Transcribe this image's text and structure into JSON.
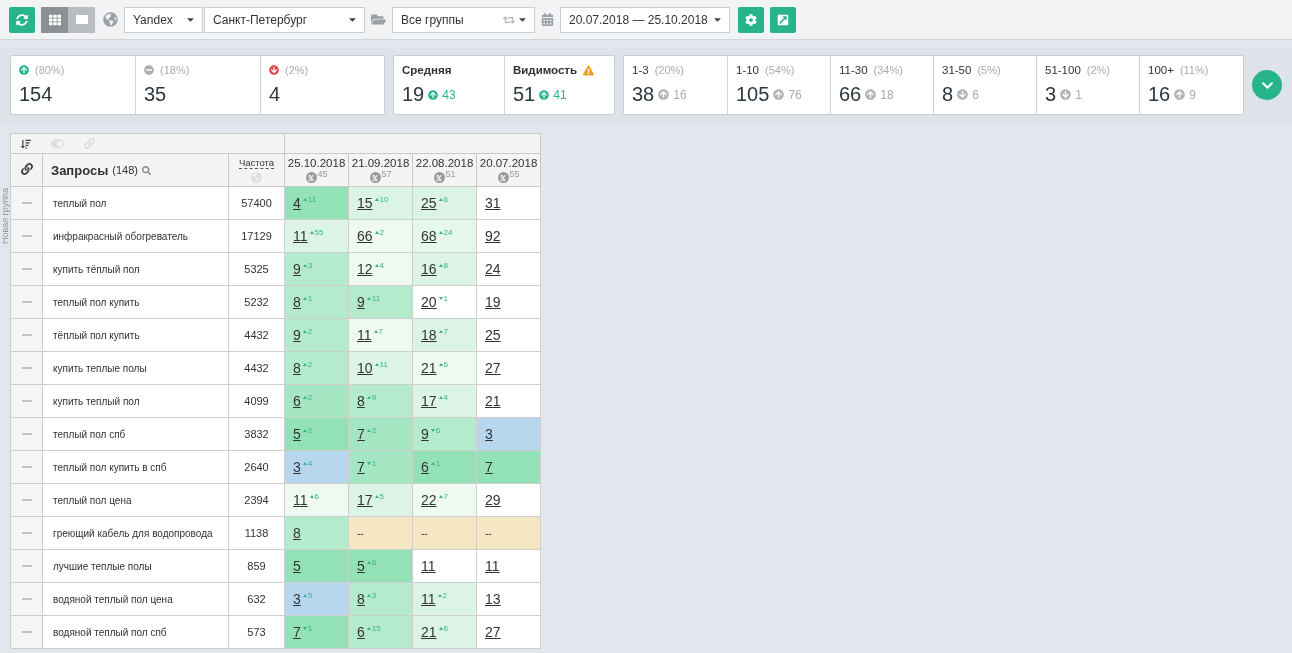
{
  "toolbar": {
    "view_modes": [
      {
        "kind": "grid",
        "selected": true
      },
      {
        "kind": "list",
        "selected": false
      }
    ],
    "search_engine": "Yandex",
    "region": "Санкт-Петербург",
    "group": "Все группы",
    "date_range": "20.07.2018 — 25.10.2018"
  },
  "summary": {
    "trend": [
      {
        "kind": "up",
        "percent": "(80%)",
        "value": "154"
      },
      {
        "kind": "same",
        "percent": "(18%)",
        "value": "35"
      },
      {
        "kind": "down",
        "percent": "(2%)",
        "value": "4"
      }
    ],
    "averages": [
      {
        "label": "Средняя",
        "value": "19",
        "delta": "43",
        "warning": false
      },
      {
        "label": "Видимость",
        "value": "51",
        "delta": "41",
        "warning": true
      }
    ],
    "ranges": [
      {
        "label": "1-3",
        "percent": "(20%)",
        "value": "38",
        "rising": true,
        "delta": "16"
      },
      {
        "label": "1-10",
        "percent": "(54%)",
        "value": "105",
        "rising": true,
        "delta": "76"
      },
      {
        "label": "11-30",
        "percent": "(34%)",
        "value": "66",
        "rising": true,
        "delta": "18"
      },
      {
        "label": "31-50",
        "percent": "(5%)",
        "value": "8",
        "rising": false,
        "delta": "6"
      },
      {
        "label": "51-100",
        "percent": "(2%)",
        "value": "3",
        "rising": false,
        "delta": "1"
      },
      {
        "label": "100+",
        "percent": "(11%)",
        "value": "16",
        "rising": true,
        "delta": "9"
      }
    ]
  },
  "table": {
    "group_label": "Новая группа",
    "query_header": "Запросы",
    "query_count": "(148)",
    "frequency_header": "Частота",
    "dates": [
      {
        "date": "25.10.2018",
        "score": "45"
      },
      {
        "date": "21.09.2018",
        "score": "57"
      },
      {
        "date": "22.08.2018",
        "score": "51"
      },
      {
        "date": "20.07.2018",
        "score": "55"
      }
    ],
    "rows": [
      {
        "query": "теплый пол",
        "frequency": "57400",
        "positions": [
          {
            "value": "4",
            "delta": "11",
            "rising": true,
            "color": "#93e2b7"
          },
          {
            "value": "15",
            "delta": "10",
            "rising": true,
            "color": "#dcf4e6"
          },
          {
            "value": "25",
            "delta": "6",
            "rising": true,
            "color": "#dcf4e6"
          },
          {
            "value": "31",
            "color": "#ffffff"
          }
        ]
      },
      {
        "query": "инфракрасный обогреватель",
        "frequency": "17129",
        "positions": [
          {
            "value": "11",
            "delta": "55",
            "rising": true,
            "color": "#dcf4e6"
          },
          {
            "value": "66",
            "delta": "2",
            "rising": true,
            "color": "#eef9f2"
          },
          {
            "value": "68",
            "delta": "24",
            "rising": true,
            "color": "#e6f7ec"
          },
          {
            "value": "92",
            "color": "#ffffff"
          }
        ]
      },
      {
        "query": "купить тёплый пол",
        "frequency": "5325",
        "positions": [
          {
            "value": "9",
            "delta": "3",
            "rising": true,
            "color": "#b5ebcd"
          },
          {
            "value": "12",
            "delta": "4",
            "rising": true,
            "color": "#eef9f2"
          },
          {
            "value": "16",
            "delta": "8",
            "rising": true,
            "color": "#dcf4e6"
          },
          {
            "value": "24",
            "color": "#ffffff"
          }
        ]
      },
      {
        "query": "теплый пол купить",
        "frequency": "5232",
        "positions": [
          {
            "value": "8",
            "delta": "1",
            "rising": true,
            "color": "#b5ebcd"
          },
          {
            "value": "9",
            "delta": "11",
            "rising": true,
            "color": "#b5ebcd"
          },
          {
            "value": "20",
            "delta": "1",
            "rising": false,
            "color": "#ffffff"
          },
          {
            "value": "19",
            "color": "#ffffff"
          }
        ]
      },
      {
        "query": "тёплый пол купить",
        "frequency": "4432",
        "positions": [
          {
            "value": "9",
            "delta": "2",
            "rising": true,
            "color": "#b5ebcd"
          },
          {
            "value": "11",
            "delta": "7",
            "rising": true,
            "color": "#eef9f2"
          },
          {
            "value": "18",
            "delta": "7",
            "rising": true,
            "color": "#dcf4e6"
          },
          {
            "value": "25",
            "color": "#ffffff"
          }
        ]
      },
      {
        "query": "купить теплые полы",
        "frequency": "4432",
        "positions": [
          {
            "value": "8",
            "delta": "2",
            "rising": true,
            "color": "#b5ebcd"
          },
          {
            "value": "10",
            "delta": "11",
            "rising": true,
            "color": "#dcf4e6"
          },
          {
            "value": "21",
            "delta": "6",
            "rising": true,
            "color": "#eef9f2"
          },
          {
            "value": "27",
            "color": "#ffffff"
          }
        ]
      },
      {
        "query": "купить теплый пол",
        "frequency": "4099",
        "positions": [
          {
            "value": "6",
            "delta": "2",
            "rising": true,
            "color": "#a3e6c1"
          },
          {
            "value": "8",
            "delta": "9",
            "rising": true,
            "color": "#b5ebcd"
          },
          {
            "value": "17",
            "delta": "4",
            "rising": true,
            "color": "#dcf4e6"
          },
          {
            "value": "21",
            "color": "#ffffff"
          }
        ]
      },
      {
        "query": "теплый пол спб",
        "frequency": "3832",
        "positions": [
          {
            "value": "5",
            "delta": "2",
            "rising": true,
            "color": "#93e2b7"
          },
          {
            "value": "7",
            "delta": "2",
            "rising": true,
            "color": "#a3e6c1"
          },
          {
            "value": "9",
            "delta": "6",
            "rising": false,
            "color": "#b5ebcd"
          },
          {
            "value": "3",
            "color": "#b7d7ef"
          }
        ]
      },
      {
        "query": "теплый пол купить в спб",
        "frequency": "2640",
        "positions": [
          {
            "value": "3",
            "delta": "4",
            "rising": true,
            "color": "#b7d7ef"
          },
          {
            "value": "7",
            "delta": "1",
            "rising": false,
            "color": "#a3e6c1"
          },
          {
            "value": "6",
            "delta": "1",
            "rising": true,
            "color": "#93e2b7"
          },
          {
            "value": "7",
            "color": "#93e2b7"
          }
        ]
      },
      {
        "query": "теплый пол цена",
        "frequency": "2394",
        "positions": [
          {
            "value": "11",
            "delta": "6",
            "rising": true,
            "color": "#eef9f2"
          },
          {
            "value": "17",
            "delta": "5",
            "rising": true,
            "color": "#dcf4e6"
          },
          {
            "value": "22",
            "delta": "7",
            "rising": true,
            "color": "#eef9f2"
          },
          {
            "value": "29",
            "color": "#ffffff"
          }
        ]
      },
      {
        "query": "греющий кабель для водопровода",
        "frequency": "1138",
        "positions": [
          {
            "value": "8",
            "color": "#b5ebcd"
          },
          {
            "value": "--",
            "color": "#f5e6c3"
          },
          {
            "value": "--",
            "color": "#f5e6c3"
          },
          {
            "value": "--",
            "color": "#f5e6c3"
          }
        ]
      },
      {
        "query": "лучшие теплые полы",
        "frequency": "859",
        "positions": [
          {
            "value": "5",
            "color": "#93e2b7"
          },
          {
            "value": "5",
            "delta": "6",
            "rising": true,
            "color": "#93e2b7"
          },
          {
            "value": "11",
            "color": "#ffffff"
          },
          {
            "value": "11",
            "color": "#ffffff"
          }
        ]
      },
      {
        "query": "водяной теплый пол цена",
        "frequency": "632",
        "positions": [
          {
            "value": "3",
            "delta": "5",
            "rising": true,
            "color": "#b7d7ef"
          },
          {
            "value": "8",
            "delta": "3",
            "rising": true,
            "color": "#b5ebcd"
          },
          {
            "value": "11",
            "delta": "2",
            "rising": true,
            "color": "#dcf4e6"
          },
          {
            "value": "13",
            "color": "#ffffff"
          }
        ]
      },
      {
        "query": "водяной теплый пол спб",
        "frequency": "573",
        "positions": [
          {
            "value": "7",
            "delta": "1",
            "rising": false,
            "color": "#93e2b7"
          },
          {
            "value": "6",
            "delta": "15",
            "rising": true,
            "color": "#b5ebcd"
          },
          {
            "value": "21",
            "delta": "6",
            "rising": true,
            "color": "#dcf4e6"
          },
          {
            "value": "27",
            "color": "#ffffff"
          }
        ]
      }
    ]
  }
}
